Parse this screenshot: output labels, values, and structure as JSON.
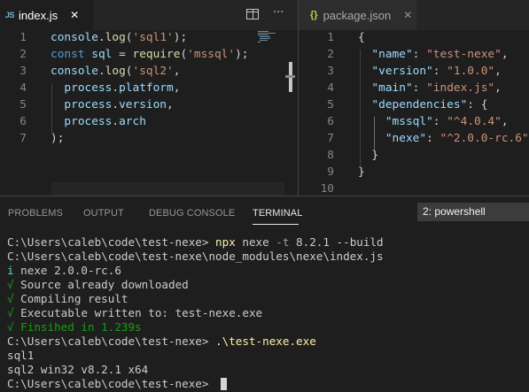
{
  "left_editor": {
    "tab": {
      "icon": "js-file-icon",
      "label": "index.js",
      "close": "✕"
    },
    "actions": {
      "split_icon": "split-editor-icon",
      "more_icon": "more-actions-icon",
      "more_label": "···"
    },
    "lines": [
      {
        "number": "1",
        "tokens": [
          [
            "console",
            "t-ident"
          ],
          [
            ".",
            "t-punc"
          ],
          [
            "log",
            "t-func"
          ],
          [
            "(",
            "t-punc"
          ],
          [
            "'sql1'",
            "t-str"
          ],
          [
            ");",
            "t-punc"
          ]
        ]
      },
      {
        "number": "2",
        "tokens": [
          [
            "const",
            "t-kw"
          ],
          [
            " ",
            "t-punc"
          ],
          [
            "sql",
            "t-ident"
          ],
          [
            " = ",
            "t-punc"
          ],
          [
            "require",
            "t-func"
          ],
          [
            "(",
            "t-punc"
          ],
          [
            "'mssql'",
            "t-str"
          ],
          [
            ");",
            "t-punc"
          ]
        ]
      },
      {
        "number": "3",
        "tokens": [
          [
            "console",
            "t-ident"
          ],
          [
            ".",
            "t-punc"
          ],
          [
            "log",
            "t-func"
          ],
          [
            "(",
            "t-punc"
          ],
          [
            "'sql2'",
            "t-str"
          ],
          [
            ",",
            "t-punc"
          ]
        ]
      },
      {
        "number": "4",
        "tokens": [
          [
            "  ",
            "t-punc"
          ],
          [
            "process",
            "t-ident"
          ],
          [
            ".",
            "t-punc"
          ],
          [
            "platform",
            "t-prop"
          ],
          [
            ",",
            "t-punc"
          ]
        ]
      },
      {
        "number": "5",
        "tokens": [
          [
            "  ",
            "t-punc"
          ],
          [
            "process",
            "t-ident"
          ],
          [
            ".",
            "t-punc"
          ],
          [
            "version",
            "t-prop"
          ],
          [
            ",",
            "t-punc"
          ]
        ]
      },
      {
        "number": "6",
        "tokens": [
          [
            "  ",
            "t-punc"
          ],
          [
            "process",
            "t-ident"
          ],
          [
            ".",
            "t-punc"
          ],
          [
            "arch",
            "t-prop"
          ]
        ]
      },
      {
        "number": "7",
        "tokens": [
          [
            ");",
            "t-punc"
          ]
        ]
      }
    ]
  },
  "right_editor": {
    "tab": {
      "icon": "json-file-icon",
      "icon_glyph": "{}",
      "label": "package.json",
      "close": "✕"
    },
    "lines": [
      {
        "number": "1",
        "tokens": [
          [
            "{",
            "t-punc"
          ]
        ]
      },
      {
        "number": "2",
        "tokens": [
          [
            "  ",
            "t-punc"
          ],
          [
            "\"name\"",
            "t-prop"
          ],
          [
            ": ",
            "t-punc"
          ],
          [
            "\"test-nexe\"",
            "t-str"
          ],
          [
            ",",
            "t-punc"
          ]
        ]
      },
      {
        "number": "3",
        "tokens": [
          [
            "  ",
            "t-punc"
          ],
          [
            "\"version\"",
            "t-prop"
          ],
          [
            ": ",
            "t-punc"
          ],
          [
            "\"1.0.0\"",
            "t-str"
          ],
          [
            ",",
            "t-punc"
          ]
        ]
      },
      {
        "number": "4",
        "tokens": [
          [
            "  ",
            "t-punc"
          ],
          [
            "\"main\"",
            "t-prop"
          ],
          [
            ": ",
            "t-punc"
          ],
          [
            "\"index.js\"",
            "t-str"
          ],
          [
            ",",
            "t-punc"
          ]
        ]
      },
      {
        "number": "5",
        "tokens": [
          [
            "  ",
            "t-punc"
          ],
          [
            "\"dependencies\"",
            "t-prop"
          ],
          [
            ": {",
            "t-punc"
          ]
        ]
      },
      {
        "number": "6",
        "tokens": [
          [
            "    ",
            "t-punc"
          ],
          [
            "\"mssql\"",
            "t-prop"
          ],
          [
            ": ",
            "t-punc"
          ],
          [
            "\"^4.0.4\"",
            "t-str"
          ],
          [
            ",",
            "t-punc"
          ]
        ]
      },
      {
        "number": "7",
        "tokens": [
          [
            "    ",
            "t-punc"
          ],
          [
            "\"nexe\"",
            "t-prop"
          ],
          [
            ": ",
            "t-punc"
          ],
          [
            "\"^2.0.0-rc.6\"",
            "t-str"
          ]
        ]
      },
      {
        "number": "8",
        "tokens": [
          [
            "  ",
            "t-punc"
          ],
          [
            "}",
            "t-punc"
          ]
        ]
      },
      {
        "number": "9",
        "tokens": [
          [
            "}",
            "t-punc"
          ]
        ]
      },
      {
        "number": "10",
        "tokens": []
      }
    ]
  },
  "panel": {
    "tabs": [
      "PROBLEMS",
      "OUTPUT",
      "DEBUG CONSOLE",
      "TERMINAL"
    ],
    "active_tab": "TERMINAL",
    "terminal_select": "2: powershell"
  },
  "terminal": {
    "lines": [
      [
        [
          "C:\\Users\\caleb\\code\\test-nexe> ",
          "c-plain"
        ],
        [
          "npx",
          "c-yellow"
        ],
        [
          " nexe ",
          "c-plain"
        ],
        [
          "-t",
          "c-grey"
        ],
        [
          " 8.2.1 --build",
          "c-plain"
        ]
      ],
      [
        [
          "C:\\Users\\caleb\\code\\test-nexe\\node_modules\\nexe\\index.js",
          "c-plain"
        ]
      ],
      [
        [
          "i",
          "c-cyan"
        ],
        [
          " nexe 2.0.0-rc.6",
          "c-plain"
        ]
      ],
      [
        [
          "√",
          "c-green"
        ],
        [
          " Source already downloaded",
          "c-plain"
        ]
      ],
      [
        [
          "√",
          "c-green"
        ],
        [
          " Compiling result",
          "c-plain"
        ]
      ],
      [
        [
          "√",
          "c-green"
        ],
        [
          " Executable written to: test-nexe.exe",
          "c-plain"
        ]
      ],
      [
        [
          "√ Finsihed in 1.239s",
          "c-green"
        ]
      ],
      [
        [
          "C:\\Users\\caleb\\code\\test-nexe> ",
          "c-plain"
        ],
        [
          ".\\test-nexe.exe",
          "c-yellow"
        ]
      ],
      [
        [
          "sql1",
          "c-plain"
        ]
      ],
      [
        [
          "sql2 win32 v8.2.1 x64",
          "c-plain"
        ]
      ],
      [
        [
          "C:\\Users\\caleb\\code\\test-nexe> ",
          "c-plain"
        ]
      ]
    ]
  }
}
